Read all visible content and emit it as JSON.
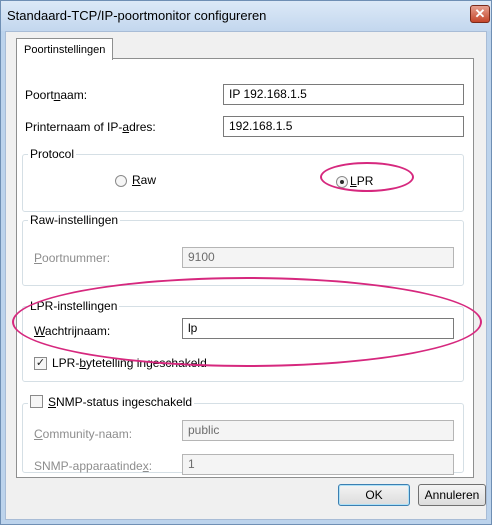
{
  "window": {
    "title": "Standaard-TCP/IP-poortmonitor configureren"
  },
  "tabs": [
    {
      "label": "Poortinstellingen"
    }
  ],
  "port_name": {
    "label_pre": "Poort",
    "label_u": "n",
    "label_post": "aam:",
    "value": "IP 192.168.1.5"
  },
  "printer_name": {
    "label_pre": "Printernaam of IP-",
    "label_u": "a",
    "label_post": "dres:",
    "value": "192.168.1.5"
  },
  "protocol": {
    "legend": "Protocol",
    "raw": {
      "label_u": "R",
      "label_post": "aw",
      "selected": false
    },
    "lpr": {
      "label_u": "L",
      "label_post": "PR",
      "selected": true
    }
  },
  "raw_settings": {
    "legend": "Raw-instellingen",
    "port_number": {
      "label_u": "P",
      "label_post": "oortnummer:",
      "value": "9100"
    }
  },
  "lpr_settings": {
    "legend": "LPR-instellingen",
    "queue_name": {
      "label_u": "W",
      "label_post": "achtrijnaam:",
      "value": "lp"
    },
    "byte_count": {
      "label_pre": "LPR-",
      "label_u": "b",
      "label_post": "ytetelling ingeschakeld",
      "checked": true,
      "check_glyph": "✓"
    }
  },
  "snmp": {
    "legend_pre": "",
    "legend_u": "S",
    "legend_post": "NMP-status ingeschakeld",
    "checked": false,
    "community": {
      "label_u": "C",
      "label_post": "ommunity-naam:",
      "value": "public"
    },
    "device_index": {
      "label_pre": "SNMP-apparaatinde",
      "label_u": "x",
      "label_post": ":",
      "value": "1"
    }
  },
  "buttons": {
    "ok": "OK",
    "cancel": "Annuleren"
  },
  "close_glyph": "✕",
  "colors": {
    "highlight": "#d6287e",
    "title_bar": "#c3d7ee",
    "close": "#c4452a"
  }
}
